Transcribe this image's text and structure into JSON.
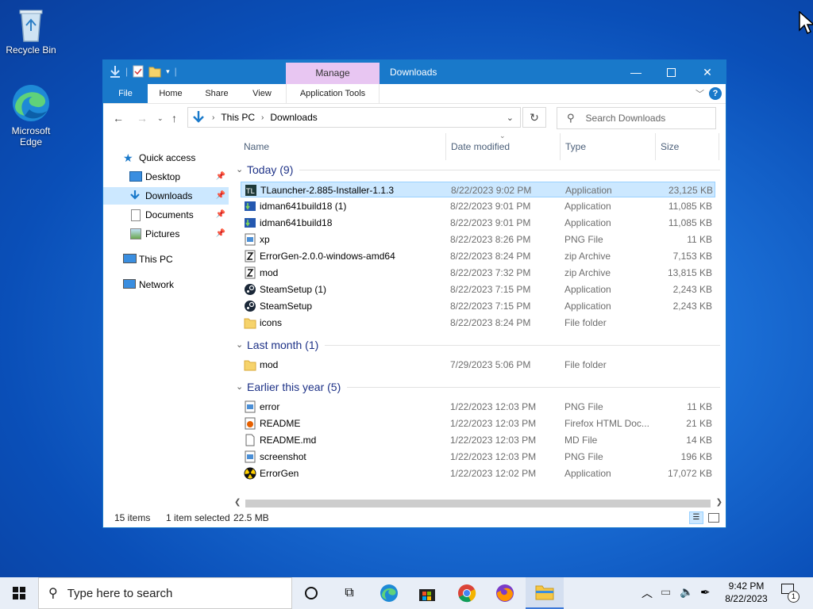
{
  "desktop": {
    "icons": [
      {
        "label": "Recycle Bin",
        "icon": "recycle-bin-icon"
      },
      {
        "label": "Microsoft Edge",
        "icon": "edge-icon"
      }
    ]
  },
  "window": {
    "title": "Downloads",
    "manage_tab": "Manage",
    "ribbon_tabs": [
      "File",
      "Home",
      "Share",
      "View",
      "Application Tools"
    ],
    "breadcrumb": [
      "This PC",
      "Downloads"
    ],
    "search_placeholder": "Search Downloads",
    "nav_pane": {
      "quick_access": "Quick access",
      "items": [
        {
          "label": "Desktop",
          "icon": "desktop-icon",
          "pinned": true
        },
        {
          "label": "Downloads",
          "icon": "downloads-icon",
          "pinned": true,
          "selected": true
        },
        {
          "label": "Documents",
          "icon": "documents-icon",
          "pinned": true
        },
        {
          "label": "Pictures",
          "icon": "pictures-icon",
          "pinned": true
        }
      ],
      "this_pc": "This PC",
      "network": "Network"
    },
    "columns": [
      "Name",
      "Date modified",
      "Type",
      "Size"
    ],
    "groups": [
      {
        "label": "Today (9)",
        "files": [
          {
            "name": "TLauncher-2.885-Installer-1.1.3",
            "date": "8/22/2023 9:02 PM",
            "type": "Application",
            "size": "23,125 KB",
            "icon": "tlauncher-icon",
            "selected": true
          },
          {
            "name": "idman641build18 (1)",
            "date": "8/22/2023 9:01 PM",
            "type": "Application",
            "size": "11,085 KB",
            "icon": "idm-icon"
          },
          {
            "name": "idman641build18",
            "date": "8/22/2023 9:01 PM",
            "type": "Application",
            "size": "11,085 KB",
            "icon": "idm-icon"
          },
          {
            "name": "xp",
            "date": "8/22/2023 8:26 PM",
            "type": "PNG File",
            "size": "11 KB",
            "icon": "image-file-icon"
          },
          {
            "name": "ErrorGen-2.0.0-windows-amd64",
            "date": "8/22/2023 8:24 PM",
            "type": "zip Archive",
            "size": "7,153 KB",
            "icon": "zip-icon"
          },
          {
            "name": "mod",
            "date": "8/22/2023 7:32 PM",
            "type": "zip Archive",
            "size": "13,815 KB",
            "icon": "zip-icon"
          },
          {
            "name": "SteamSetup (1)",
            "date": "8/22/2023 7:15 PM",
            "type": "Application",
            "size": "2,243 KB",
            "icon": "steam-icon"
          },
          {
            "name": "SteamSetup",
            "date": "8/22/2023 7:15 PM",
            "type": "Application",
            "size": "2,243 KB",
            "icon": "steam-icon"
          },
          {
            "name": "icons",
            "date": "8/22/2023 8:24 PM",
            "type": "File folder",
            "size": "",
            "icon": "folder-icon"
          }
        ]
      },
      {
        "label": "Last month (1)",
        "files": [
          {
            "name": "mod",
            "date": "7/29/2023 5:06 PM",
            "type": "File folder",
            "size": "",
            "icon": "folder-icon"
          }
        ]
      },
      {
        "label": "Earlier this year (5)",
        "files": [
          {
            "name": "error",
            "date": "1/22/2023 12:03 PM",
            "type": "PNG File",
            "size": "11 KB",
            "icon": "image-file-icon"
          },
          {
            "name": "README",
            "date": "1/22/2023 12:03 PM",
            "type": "Firefox HTML Doc...",
            "size": "21 KB",
            "icon": "html-file-icon"
          },
          {
            "name": "README.md",
            "date": "1/22/2023 12:03 PM",
            "type": "MD File",
            "size": "14 KB",
            "icon": "text-file-icon"
          },
          {
            "name": "screenshot",
            "date": "1/22/2023 12:03 PM",
            "type": "PNG File",
            "size": "196 KB",
            "icon": "image-file-icon"
          },
          {
            "name": "ErrorGen",
            "date": "1/22/2023 12:02 PM",
            "type": "Application",
            "size": "17,072 KB",
            "icon": "radiation-icon"
          }
        ]
      }
    ],
    "status": {
      "items": "15 items",
      "selected": "1 item selected",
      "size": "22.5 MB"
    }
  },
  "taskbar": {
    "search_placeholder": "Type here to search",
    "time": "9:42 PM",
    "date": "8/22/2023",
    "notifications": "1"
  }
}
